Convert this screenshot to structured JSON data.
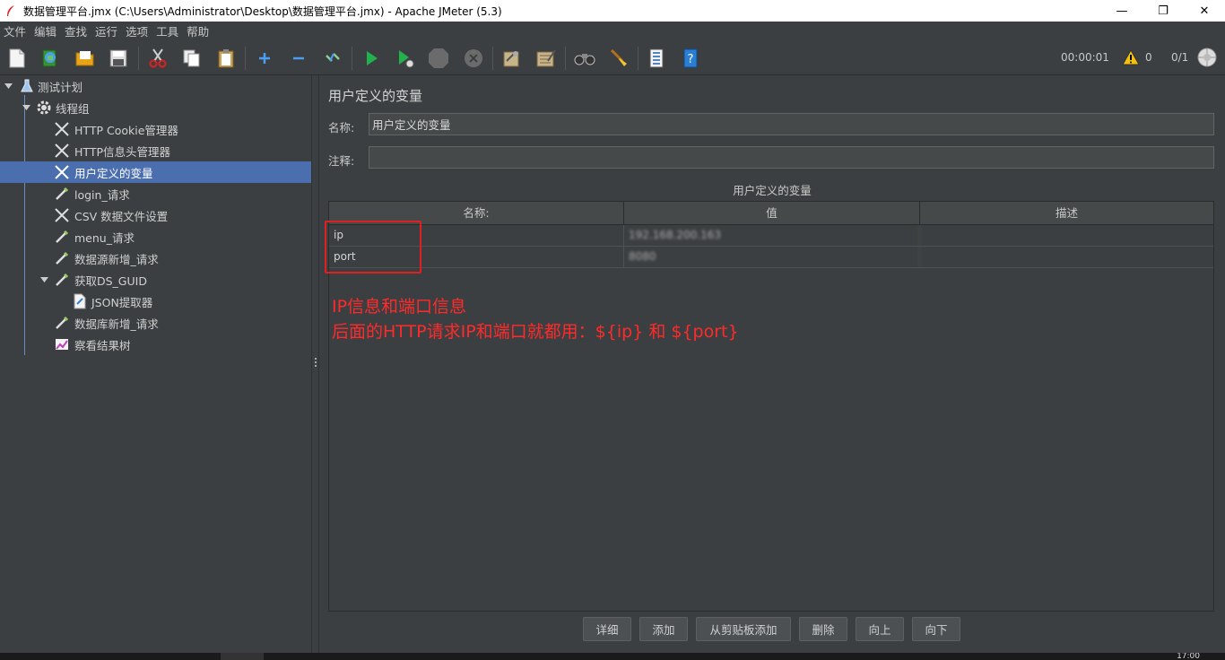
{
  "window": {
    "title": "数据管理平台.jmx (C:\\Users\\Administrator\\Desktop\\数据管理平台.jmx) - Apache JMeter (5.3)",
    "minimize": "—",
    "maximize": "❐",
    "close": "✕"
  },
  "menu": [
    "文件",
    "编辑",
    "查找",
    "运行",
    "选项",
    "工具",
    "帮助"
  ],
  "toolbar": {
    "icons": [
      "new-icon",
      "templates-icon",
      "open-icon",
      "save-icon",
      "cut-icon",
      "copy-icon",
      "paste-icon",
      "expand-icon",
      "collapse-icon",
      "toggle-icon",
      "start-icon",
      "start-no-pause-icon",
      "stop-icon",
      "shutdown-icon",
      "clear-icon",
      "clear-all-icon",
      "search-icon",
      "reset-search-icon",
      "function-helper-icon",
      "help-icon"
    ],
    "elapsed_time": "00:00:01",
    "warning_count": "0",
    "thread_count": "0/1"
  },
  "tree": [
    {
      "label": "测试计划",
      "icon": "flask-icon",
      "expanded": true
    },
    {
      "label": "线程组",
      "icon": "gear-icon",
      "expanded": true
    },
    {
      "label": "HTTP Cookie管理器",
      "icon": "tools-icon"
    },
    {
      "label": "HTTP信息头管理器",
      "icon": "tools-icon"
    },
    {
      "label": "用户定义的变量",
      "icon": "tools-icon",
      "selected": true
    },
    {
      "label": "login_请求",
      "icon": "pipette-icon"
    },
    {
      "label": "CSV 数据文件设置",
      "icon": "tools-icon"
    },
    {
      "label": "menu_请求",
      "icon": "pipette-icon"
    },
    {
      "label": "数据源新增_请求",
      "icon": "pipette-icon"
    },
    {
      "label": "获取DS_GUID",
      "icon": "pipette-icon",
      "expanded": true
    },
    {
      "label": "JSON提取器",
      "icon": "document-icon"
    },
    {
      "label": "数据库新增_请求",
      "icon": "pipette-icon"
    },
    {
      "label": "察看结果树",
      "icon": "chart-icon"
    }
  ],
  "panel": {
    "title": "用户定义的变量",
    "name_label": "名称:",
    "name_value": "用户定义的变量",
    "comment_label": "注释:",
    "comment_value": "",
    "section_title": "用户定义的变量"
  },
  "table": {
    "headers": [
      "名称:",
      "值",
      "描述"
    ],
    "rows": [
      {
        "name": "ip",
        "value": "192.168.200.163",
        "desc": ""
      },
      {
        "name": "port",
        "value": "8080",
        "desc": ""
      }
    ]
  },
  "annotation": {
    "line1": "IP信息和端口信息",
    "line2": "后面的HTTP请求IP和端口就都用：${ip} 和 ${port}"
  },
  "buttons": [
    "详细",
    "添加",
    "从剪贴板添加",
    "删除",
    "向上",
    "向下"
  ],
  "taskbar": {
    "clock": "17:00"
  },
  "colors": {
    "background": "#3c3f41",
    "selection": "#4b6eaf",
    "annotation": "#ff2a2a"
  }
}
